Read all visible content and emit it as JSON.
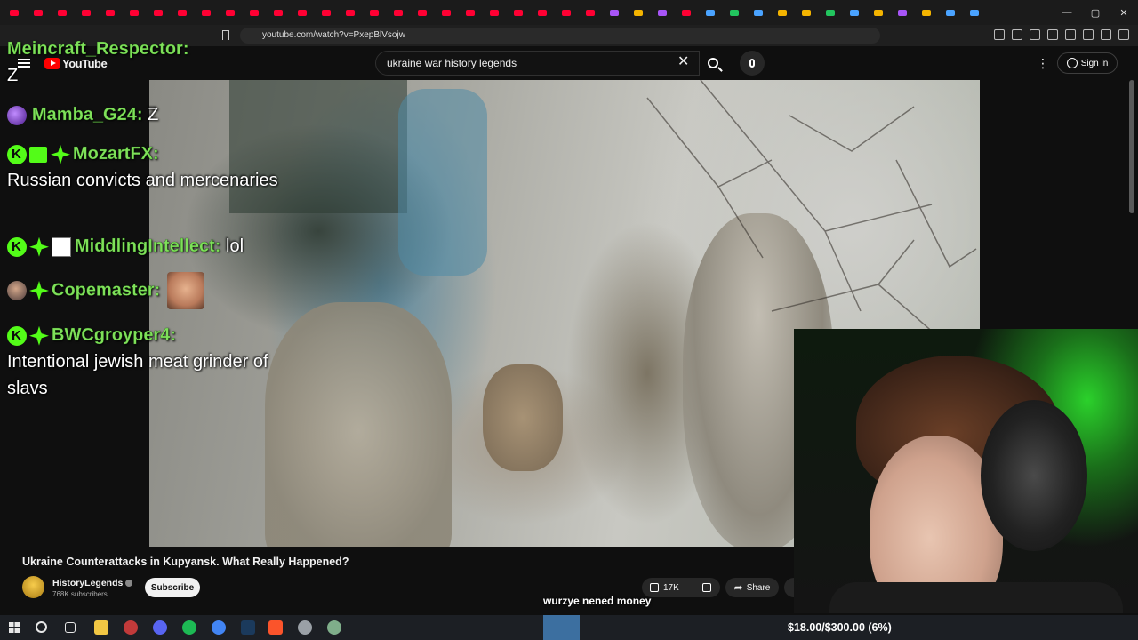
{
  "browser": {
    "url": "youtube.com/watch?v=PxepBlVsojw",
    "window_controls": [
      "—",
      "▢",
      "✕"
    ]
  },
  "youtube": {
    "logo_text": "YouTube",
    "search_query": "ukraine war history legends",
    "signin_label": "Sign in",
    "video_title": "Ukraine Counterattacks in Kupyansk. What Really Happened?",
    "channel_name": "HistoryLegends",
    "subscribers": "768K subscribers",
    "subscribe_label": "Subscribe",
    "likes": "17K",
    "share_label": "Share"
  },
  "chat": [
    {
      "user": "Meincraft_Respector:",
      "text": "Z"
    },
    {
      "user": "Mamba_G24:",
      "text": "Z"
    },
    {
      "user": "MozartFX:",
      "text": "Russian convicts and mercenaries"
    },
    {
      "user": "MiddlingIntellect:",
      "text": "lol"
    },
    {
      "user": "Copemaster:",
      "text": ""
    },
    {
      "user": "BWCgroyper4:",
      "text": "Intentional jewish meat grinder of slavs"
    }
  ],
  "overlay": {
    "caption": "wurzye nened money",
    "donation_goal": "$18.00/$300.00 (6%)"
  },
  "colors": {
    "chat_username": "#7fe05a",
    "kick_badge": "#53fc18",
    "youtube_red": "#ff0000"
  }
}
